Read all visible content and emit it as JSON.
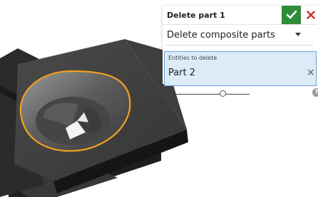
{
  "dialog": {
    "title": "Delete part 1",
    "mode_value": "Delete composite parts",
    "entities_label": "Entities to delete",
    "entities": [
      {
        "label": "Part 2"
      }
    ],
    "remove_glyph": "×",
    "help_glyph": "?",
    "slider_value_fraction": 0.68
  },
  "icons": {
    "accept": "checkmark-icon",
    "cancel": "close-icon",
    "dropdown": "caret-down-icon",
    "help": "help-icon",
    "remove": "remove-icon"
  },
  "colors": {
    "accept_bg": "#2f8c3a",
    "cancel": "#d32f2f",
    "selection_highlight": "#f0a020",
    "query_bg": "#dcebf8",
    "query_border": "#6ea2d6",
    "part_dark": "#333333"
  }
}
